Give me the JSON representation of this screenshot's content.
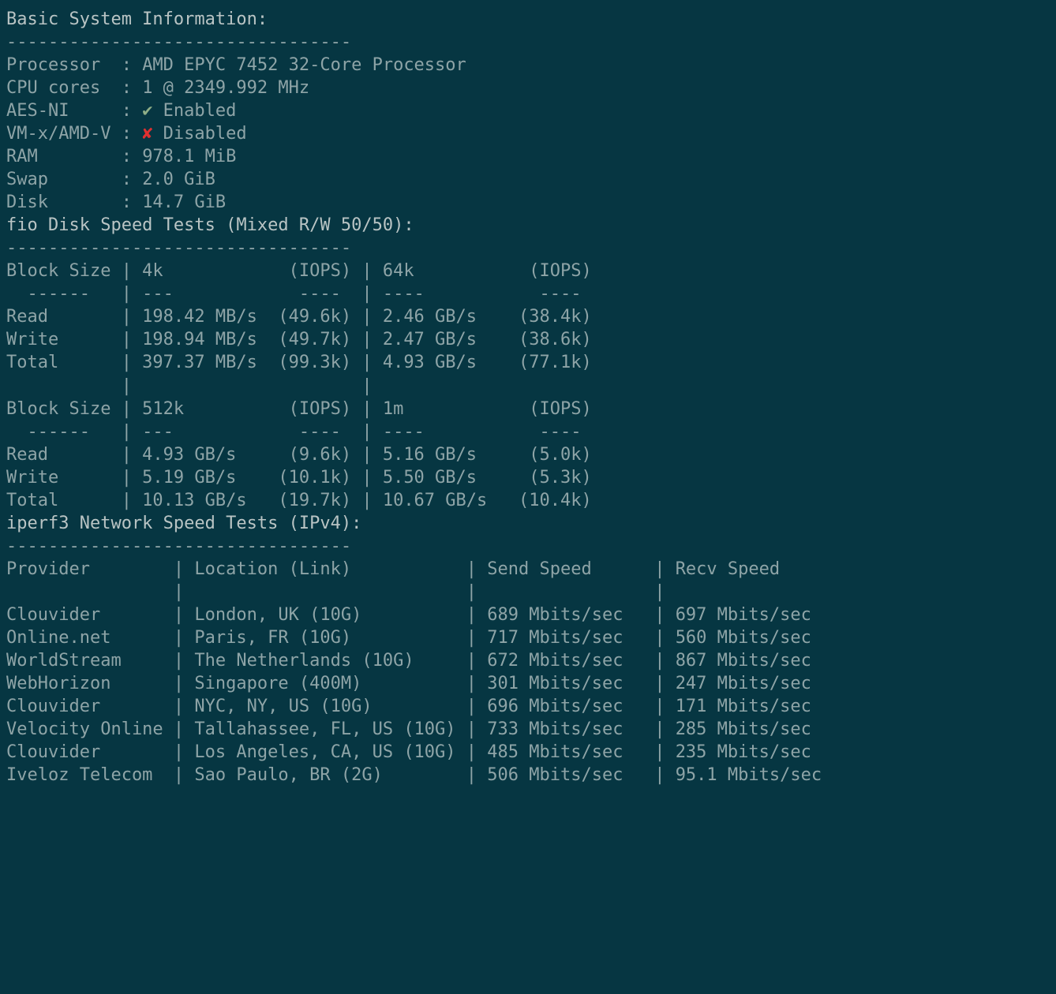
{
  "sections": {
    "basic": {
      "title": "Basic System Information:",
      "dashes": "---------------------------------",
      "rows": [
        {
          "label": "Processor",
          "pad": "  ",
          "value": "AMD EPYC 7452 32-Core Processor",
          "flag": ""
        },
        {
          "label": "CPU cores",
          "pad": "  ",
          "value": "1 @ 2349.992 MHz",
          "flag": ""
        },
        {
          "label": "AES-NI",
          "pad": "     ",
          "value": " Enabled",
          "flag": "tick"
        },
        {
          "label": "VM-x/AMD-V",
          "pad": " ",
          "value": " Disabled",
          "flag": "cross"
        },
        {
          "label": "RAM",
          "pad": "        ",
          "value": "978.1 MiB",
          "flag": ""
        },
        {
          "label": "Swap",
          "pad": "       ",
          "value": "2.0 GiB",
          "flag": ""
        },
        {
          "label": "Disk",
          "pad": "       ",
          "value": "14.7 GiB",
          "flag": ""
        }
      ]
    },
    "fio": {
      "title": "fio Disk Speed Tests (Mixed R/W 50/50):",
      "dashes": "---------------------------------",
      "header_top": "Block Size | 4k            (IOPS) | 64k           (IOPS)",
      "under_top": "  ------   | ---            ----  | ----           ---- ",
      "rows_top": [
        "Read       | 198.42 MB/s  (49.6k) | 2.46 GB/s    (38.4k)",
        "Write      | 198.94 MB/s  (49.7k) | 2.47 GB/s    (38.6k)",
        "Total      | 397.37 MB/s  (99.3k) | 4.93 GB/s    (77.1k)"
      ],
      "blank_mid": "           |                      |                     ",
      "header_bot": "Block Size | 512k          (IOPS) | 1m            (IOPS)",
      "under_bot": "  ------   | ---            ----  | ----           ---- ",
      "rows_bot": [
        "Read       | 4.93 GB/s     (9.6k) | 5.16 GB/s     (5.0k)",
        "Write      | 5.19 GB/s    (10.1k) | 5.50 GB/s     (5.3k)",
        "Total      | 10.13 GB/s   (19.7k) | 10.67 GB/s   (10.4k)"
      ]
    },
    "iperf": {
      "title": "iperf3 Network Speed Tests (IPv4):",
      "dashes": "---------------------------------",
      "header": "Provider        | Location (Link)           | Send Speed      | Recv Speed     ",
      "blank": "                |                           |                 |                ",
      "rows": [
        "Clouvider       | London, UK (10G)          | 689 Mbits/sec   | 697 Mbits/sec  ",
        "Online.net      | Paris, FR (10G)           | 717 Mbits/sec   | 560 Mbits/sec  ",
        "WorldStream     | The Netherlands (10G)     | 672 Mbits/sec   | 867 Mbits/sec  ",
        "WebHorizon      | Singapore (400M)          | 301 Mbits/sec   | 247 Mbits/sec  ",
        "Clouvider       | NYC, NY, US (10G)         | 696 Mbits/sec   | 171 Mbits/sec  ",
        "Velocity Online | Tallahassee, FL, US (10G) | 733 Mbits/sec   | 285 Mbits/sec  ",
        "Clouvider       | Los Angeles, CA, US (10G) | 485 Mbits/sec   | 235 Mbits/sec  ",
        "Iveloz Telecom  | Sao Paulo, BR (2G)        | 506 Mbits/sec   | 95.1 Mbits/sec "
      ]
    }
  },
  "glyphs": {
    "tick": "✔",
    "cross": "✘"
  }
}
